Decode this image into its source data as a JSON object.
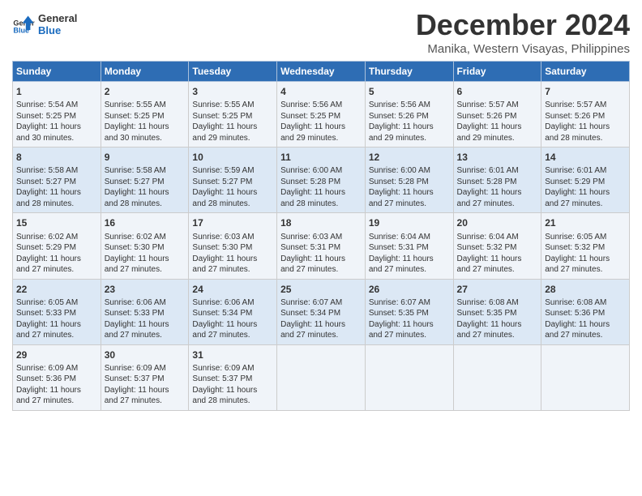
{
  "header": {
    "logo_line1": "General",
    "logo_line2": "Blue",
    "month_year": "December 2024",
    "location": "Manika, Western Visayas, Philippines"
  },
  "calendar": {
    "days_of_week": [
      "Sunday",
      "Monday",
      "Tuesday",
      "Wednesday",
      "Thursday",
      "Friday",
      "Saturday"
    ],
    "weeks": [
      [
        {
          "day": "",
          "text": ""
        },
        {
          "day": "2",
          "text": "Sunrise: 5:55 AM\nSunset: 5:25 PM\nDaylight: 11 hours\nand 30 minutes."
        },
        {
          "day": "3",
          "text": "Sunrise: 5:55 AM\nSunset: 5:25 PM\nDaylight: 11 hours\nand 29 minutes."
        },
        {
          "day": "4",
          "text": "Sunrise: 5:56 AM\nSunset: 5:25 PM\nDaylight: 11 hours\nand 29 minutes."
        },
        {
          "day": "5",
          "text": "Sunrise: 5:56 AM\nSunset: 5:26 PM\nDaylight: 11 hours\nand 29 minutes."
        },
        {
          "day": "6",
          "text": "Sunrise: 5:57 AM\nSunset: 5:26 PM\nDaylight: 11 hours\nand 29 minutes."
        },
        {
          "day": "7",
          "text": "Sunrise: 5:57 AM\nSunset: 5:26 PM\nDaylight: 11 hours\nand 28 minutes."
        }
      ],
      [
        {
          "day": "1",
          "text": "Sunrise: 5:54 AM\nSunset: 5:25 PM\nDaylight: 11 hours\nand 30 minutes."
        },
        {
          "day": "9",
          "text": "Sunrise: 5:58 AM\nSunset: 5:27 PM\nDaylight: 11 hours\nand 28 minutes."
        },
        {
          "day": "10",
          "text": "Sunrise: 5:59 AM\nSunset: 5:27 PM\nDaylight: 11 hours\nand 28 minutes."
        },
        {
          "day": "11",
          "text": "Sunrise: 6:00 AM\nSunset: 5:28 PM\nDaylight: 11 hours\nand 28 minutes."
        },
        {
          "day": "12",
          "text": "Sunrise: 6:00 AM\nSunset: 5:28 PM\nDaylight: 11 hours\nand 27 minutes."
        },
        {
          "day": "13",
          "text": "Sunrise: 6:01 AM\nSunset: 5:28 PM\nDaylight: 11 hours\nand 27 minutes."
        },
        {
          "day": "14",
          "text": "Sunrise: 6:01 AM\nSunset: 5:29 PM\nDaylight: 11 hours\nand 27 minutes."
        }
      ],
      [
        {
          "day": "8",
          "text": "Sunrise: 5:58 AM\nSunset: 5:27 PM\nDaylight: 11 hours\nand 28 minutes."
        },
        {
          "day": "16",
          "text": "Sunrise: 6:02 AM\nSunset: 5:30 PM\nDaylight: 11 hours\nand 27 minutes."
        },
        {
          "day": "17",
          "text": "Sunrise: 6:03 AM\nSunset: 5:30 PM\nDaylight: 11 hours\nand 27 minutes."
        },
        {
          "day": "18",
          "text": "Sunrise: 6:03 AM\nSunset: 5:31 PM\nDaylight: 11 hours\nand 27 minutes."
        },
        {
          "day": "19",
          "text": "Sunrise: 6:04 AM\nSunset: 5:31 PM\nDaylight: 11 hours\nand 27 minutes."
        },
        {
          "day": "20",
          "text": "Sunrise: 6:04 AM\nSunset: 5:32 PM\nDaylight: 11 hours\nand 27 minutes."
        },
        {
          "day": "21",
          "text": "Sunrise: 6:05 AM\nSunset: 5:32 PM\nDaylight: 11 hours\nand 27 minutes."
        }
      ],
      [
        {
          "day": "15",
          "text": "Sunrise: 6:02 AM\nSunset: 5:29 PM\nDaylight: 11 hours\nand 27 minutes."
        },
        {
          "day": "23",
          "text": "Sunrise: 6:06 AM\nSunset: 5:33 PM\nDaylight: 11 hours\nand 27 minutes."
        },
        {
          "day": "24",
          "text": "Sunrise: 6:06 AM\nSunset: 5:34 PM\nDaylight: 11 hours\nand 27 minutes."
        },
        {
          "day": "25",
          "text": "Sunrise: 6:07 AM\nSunset: 5:34 PM\nDaylight: 11 hours\nand 27 minutes."
        },
        {
          "day": "26",
          "text": "Sunrise: 6:07 AM\nSunset: 5:35 PM\nDaylight: 11 hours\nand 27 minutes."
        },
        {
          "day": "27",
          "text": "Sunrise: 6:08 AM\nSunset: 5:35 PM\nDaylight: 11 hours\nand 27 minutes."
        },
        {
          "day": "28",
          "text": "Sunrise: 6:08 AM\nSunset: 5:36 PM\nDaylight: 11 hours\nand 27 minutes."
        }
      ],
      [
        {
          "day": "22",
          "text": "Sunrise: 6:05 AM\nSunset: 5:33 PM\nDaylight: 11 hours\nand 27 minutes."
        },
        {
          "day": "30",
          "text": "Sunrise: 6:09 AM\nSunset: 5:37 PM\nDaylight: 11 hours\nand 27 minutes."
        },
        {
          "day": "31",
          "text": "Sunrise: 6:09 AM\nSunset: 5:37 PM\nDaylight: 11 hours\nand 28 minutes."
        },
        {
          "day": "",
          "text": ""
        },
        {
          "day": "",
          "text": ""
        },
        {
          "day": "",
          "text": ""
        },
        {
          "day": "",
          "text": ""
        }
      ],
      [
        {
          "day": "29",
          "text": "Sunrise: 6:09 AM\nSunset: 5:36 PM\nDaylight: 11 hours\nand 27 minutes."
        },
        {
          "day": "",
          "text": ""
        },
        {
          "day": "",
          "text": ""
        },
        {
          "day": "",
          "text": ""
        },
        {
          "day": "",
          "text": ""
        },
        {
          "day": "",
          "text": ""
        },
        {
          "day": "",
          "text": ""
        }
      ]
    ]
  }
}
